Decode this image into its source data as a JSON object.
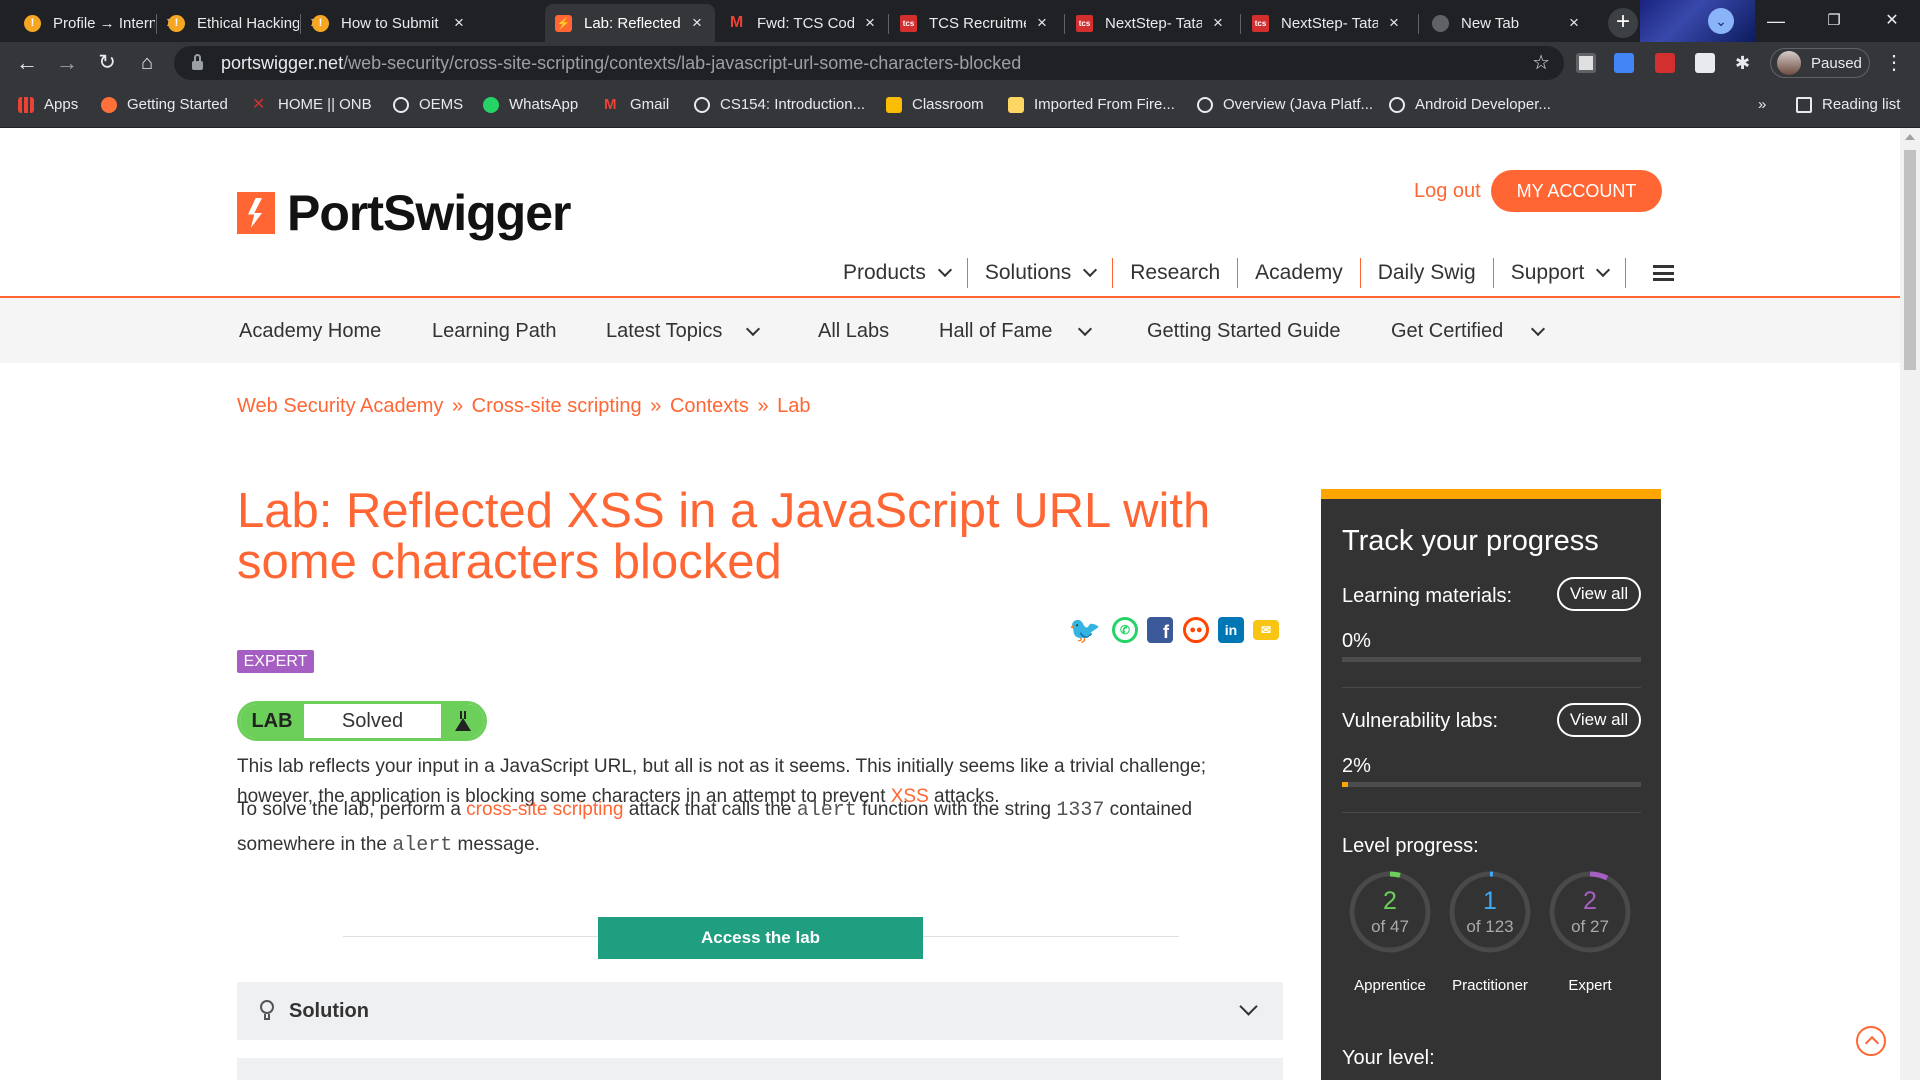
{
  "tabs": [
    {
      "title": "Profile → Intern",
      "favicon_color": "#f5a623"
    },
    {
      "title": "Ethical Hacking",
      "favicon_color": "#f5a623"
    },
    {
      "title": "How to Submit",
      "favicon_color": "#f5a623"
    },
    {
      "title": "Lab: Reflected",
      "favicon_color": "#ff6633",
      "active": true
    },
    {
      "title": "Fwd: TCS Code",
      "favicon_color": "#ea4335"
    },
    {
      "title": "TCS Recruitme",
      "favicon_color": "#d32f2f"
    },
    {
      "title": "NextStep- Tata",
      "favicon_color": "#d32f2f"
    },
    {
      "title": "NextStep- Tata",
      "favicon_color": "#d32f2f"
    },
    {
      "title": "New Tab",
      "favicon_color": "#5f6368"
    }
  ],
  "window": {
    "minimize": "—",
    "restore": "❐",
    "close": "✕",
    "new_tab": "+",
    "profile_icon": "⌄"
  },
  "address": {
    "host": "portswigger.net",
    "path": "/web-security/cross-site-scripting/contexts/lab-javascript-url-some-characters-blocked"
  },
  "profile": {
    "status": "Paused"
  },
  "bookmarks": [
    {
      "label": "Apps",
      "icon": "apps-grid-icon"
    },
    {
      "label": "Getting Started",
      "icon": "firefox-icon"
    },
    {
      "label": "HOME || ONB",
      "icon": "x-icon"
    },
    {
      "label": "OEMS",
      "icon": "globe-icon"
    },
    {
      "label": "WhatsApp",
      "icon": "whatsapp-icon"
    },
    {
      "label": "Gmail",
      "icon": "gmail-icon"
    },
    {
      "label": "CS154: Introduction...",
      "icon": "globe-icon"
    },
    {
      "label": "Classroom",
      "icon": "classroom-icon"
    },
    {
      "label": "Imported From Fire...",
      "icon": "folder-icon"
    },
    {
      "label": "Overview (Java Platf...",
      "icon": "globe-icon"
    },
    {
      "label": "Android Developer...",
      "icon": "globe-icon"
    }
  ],
  "bookmarks_overflow": "»",
  "reading_list": "Reading list",
  "site": {
    "logo_text": "PortSwigger",
    "logout": "Log out",
    "my_account": "MY ACCOUNT",
    "topnav": [
      "Products",
      "Solutions",
      "Research",
      "Academy",
      "Daily Swig",
      "Support"
    ],
    "subnav": [
      "Academy Home",
      "Learning Path",
      "Latest Topics",
      "All Labs",
      "Hall of Fame",
      "Getting Started Guide",
      "Get Certified"
    ]
  },
  "breadcrumb": [
    "Web Security Academy",
    "Cross-site scripting",
    "Contexts",
    "Lab"
  ],
  "breadcrumb_separator": "»",
  "lab": {
    "title": "Lab: Reflected XSS in a JavaScript URL with some characters blocked",
    "level": "EXPERT",
    "status_label": "LAB",
    "status": "Solved",
    "desc1_a": "This lab reflects your input in a JavaScript URL, but all is not as it seems. This initially seems like a trivial challenge; however, the application is blocking some characters in an attempt to prevent ",
    "desc1_link": "XSS",
    "desc1_b": " attacks.",
    "desc2_a": "To solve the lab, perform a ",
    "desc2_link": "cross-site scripting",
    "desc2_b": " attack that calls the ",
    "desc2_code1": "alert",
    "desc2_c": " function with the string ",
    "desc2_code2": "1337",
    "desc2_d": " contained somewhere in the ",
    "desc2_code3": "alert",
    "desc2_e": " message.",
    "access_button": "Access the lab",
    "solution_label": "Solution"
  },
  "share_icons": [
    "twitter-icon",
    "whatsapp-icon",
    "facebook-icon",
    "reddit-icon",
    "linkedin-icon",
    "email-icon"
  ],
  "progress": {
    "title": "Track your progress",
    "learning_label": "Learning materials:",
    "learning_pct": "0%",
    "learning_value": 0,
    "vuln_label": "Vulnerability labs:",
    "vuln_pct": "2%",
    "vuln_value": 0.02,
    "view_all": "View all",
    "level_label": "Level progress:",
    "levels": [
      {
        "name": "Apprentice",
        "done": "2",
        "of": "of 47",
        "color": "#6ccf5a",
        "fraction": 0.0426
      },
      {
        "name": "Practitioner",
        "done": "1",
        "of": "of 123",
        "color": "#3fa9f5",
        "fraction": 0.0081
      },
      {
        "name": "Expert",
        "done": "2",
        "of": "of 27",
        "color": "#a55fc2",
        "fraction": 0.074
      }
    ],
    "your_level": "Your level:"
  },
  "colors": {
    "brand": "#ff6633",
    "solved_green": "#6ccf5a",
    "access_btn": "#1f9e80",
    "expert_purple": "#a55fc2",
    "sidebar_bg": "#333333",
    "sidebar_accent": "#ffa500"
  }
}
